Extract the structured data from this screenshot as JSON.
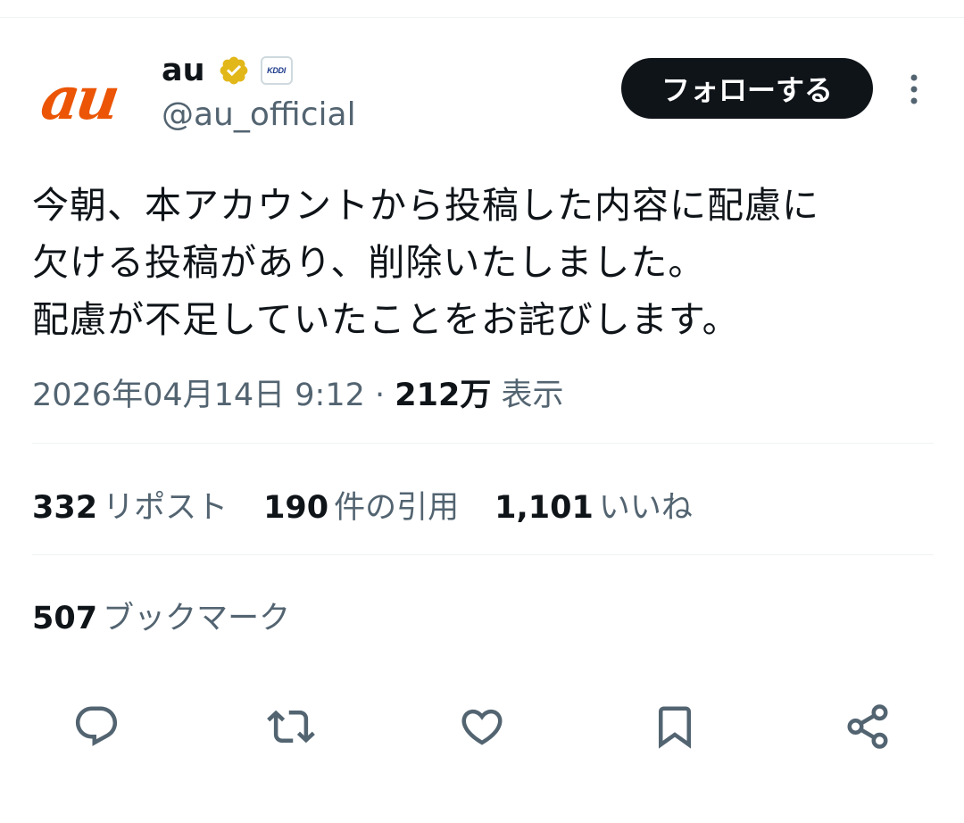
{
  "author": {
    "avatar_text": "au",
    "display_name": "au",
    "affiliate_badge": "KDDI",
    "handle": "@au_official"
  },
  "follow_button": {
    "label": "フォローする"
  },
  "tweet": {
    "lines": [
      "今朝、本アカウントから投稿した内容に配慮に",
      "欠ける投稿があり、削除いたしました。",
      "配慮が不足していたことをお詫びします。"
    ],
    "timestamp": "2026年04月14日 9:12",
    "separator": "·",
    "views_count": "212万",
    "views_label": "表示"
  },
  "stats": {
    "reposts": {
      "count": "332",
      "label": "リポスト"
    },
    "quotes": {
      "count": "190",
      "label": "件の引用"
    },
    "likes": {
      "count": "1,101",
      "label": "いいね"
    },
    "bookmarks": {
      "count": "507",
      "label": "ブックマーク"
    }
  },
  "icons": {
    "verified": "verified-badge-icon",
    "more": "more-vertical-icon",
    "actions": [
      "reply-icon",
      "repost-icon",
      "like-icon",
      "bookmark-icon",
      "share-icon"
    ]
  },
  "colors": {
    "brand_orange": "#eb5505",
    "verified_gold": "#e2b719",
    "text_primary": "#0f1419",
    "text_secondary": "#536471",
    "divider": "#eff3f4"
  }
}
